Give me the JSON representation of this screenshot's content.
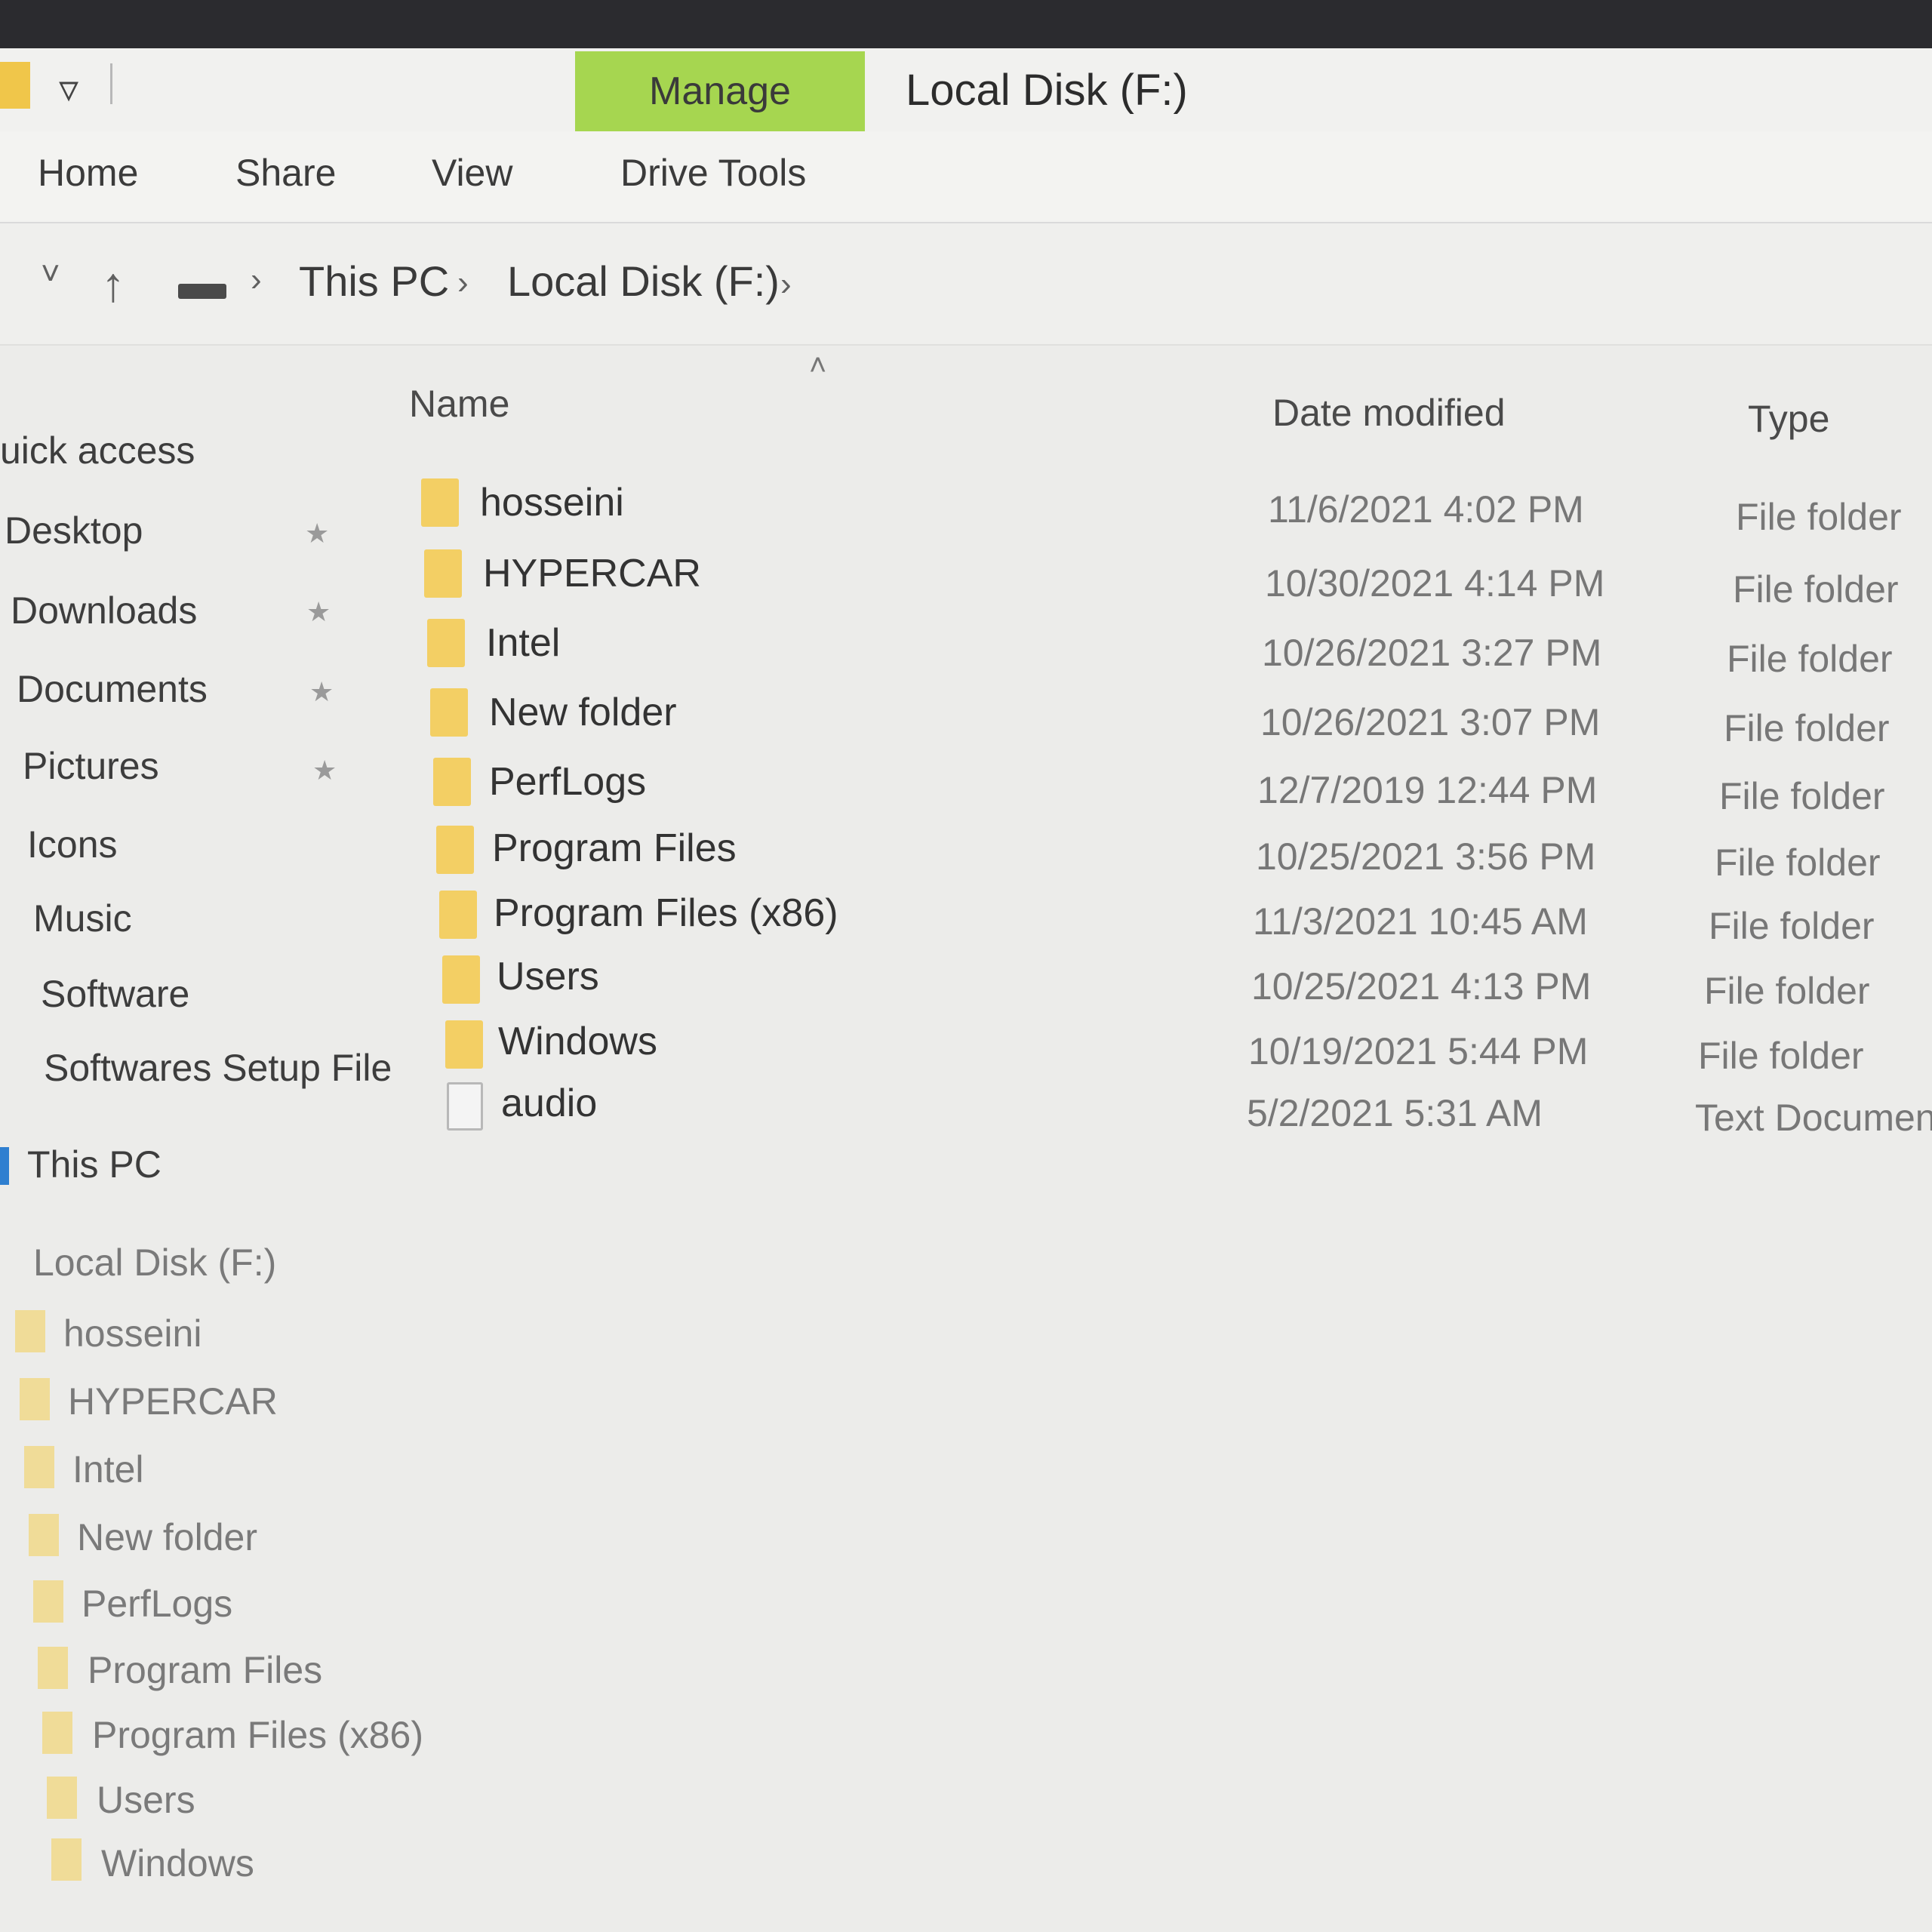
{
  "window": {
    "title": "Local Disk (F:)",
    "context_tab": "Manage",
    "quick_access_menu_glyph": "▿"
  },
  "ribbon": {
    "tabs": [
      "Home",
      "Share",
      "View",
      "Drive Tools"
    ]
  },
  "address_bar": {
    "breadcrumbs": [
      "This PC",
      "Local Disk (F:)"
    ],
    "separator": "›",
    "up_glyph": "↑",
    "recent_glyph": "˅"
  },
  "sidebar": {
    "quick_access": "uick access",
    "pinned": [
      "Desktop",
      "Downloads",
      "Documents",
      "Pictures"
    ],
    "others": [
      "Icons",
      "Music",
      "Software",
      "Softwares Setup File"
    ],
    "this_pc": "This PC",
    "drive": "Local Disk (F:)",
    "drive_children": [
      "hosseini",
      "HYPERCAR",
      "Intel",
      "New folder",
      "PerfLogs",
      "Program Files",
      "Program Files (x86)",
      "Users",
      "Windows"
    ],
    "pin_glyph": "★"
  },
  "file_list": {
    "columns": {
      "name": "Name",
      "date": "Date modified",
      "type": "Type"
    },
    "sort_glyph": "˄",
    "rows": [
      {
        "name": "hosseini",
        "date": "11/6/2021 4:02 PM",
        "type": "File folder",
        "icon": "folder-icon"
      },
      {
        "name": "HYPERCAR",
        "date": "10/30/2021 4:14 PM",
        "type": "File folder",
        "icon": "folder-icon"
      },
      {
        "name": "Intel",
        "date": "10/26/2021 3:27 PM",
        "type": "File folder",
        "icon": "folder-icon"
      },
      {
        "name": "New folder",
        "date": "10/26/2021 3:07 PM",
        "type": "File folder",
        "icon": "folder-icon"
      },
      {
        "name": "PerfLogs",
        "date": "12/7/2019 12:44 PM",
        "type": "File folder",
        "icon": "folder-icon"
      },
      {
        "name": "Program Files",
        "date": "10/25/2021 3:56 PM",
        "type": "File folder",
        "icon": "folder-icon"
      },
      {
        "name": "Program Files (x86)",
        "date": "11/3/2021 10:45 AM",
        "type": "File folder",
        "icon": "folder-icon"
      },
      {
        "name": "Users",
        "date": "10/25/2021 4:13 PM",
        "type": "File folder",
        "icon": "folder-icon"
      },
      {
        "name": "Windows",
        "date": "10/19/2021 5:44 PM",
        "type": "File folder",
        "icon": "folder-icon"
      },
      {
        "name": "audio",
        "date": "5/2/2021 5:31 AM",
        "type": "Text Documen",
        "icon": "text-document-icon"
      }
    ]
  },
  "colors": {
    "manage_tab": "#a6d650",
    "folder": "#f3cf64",
    "background": "#ececea"
  }
}
